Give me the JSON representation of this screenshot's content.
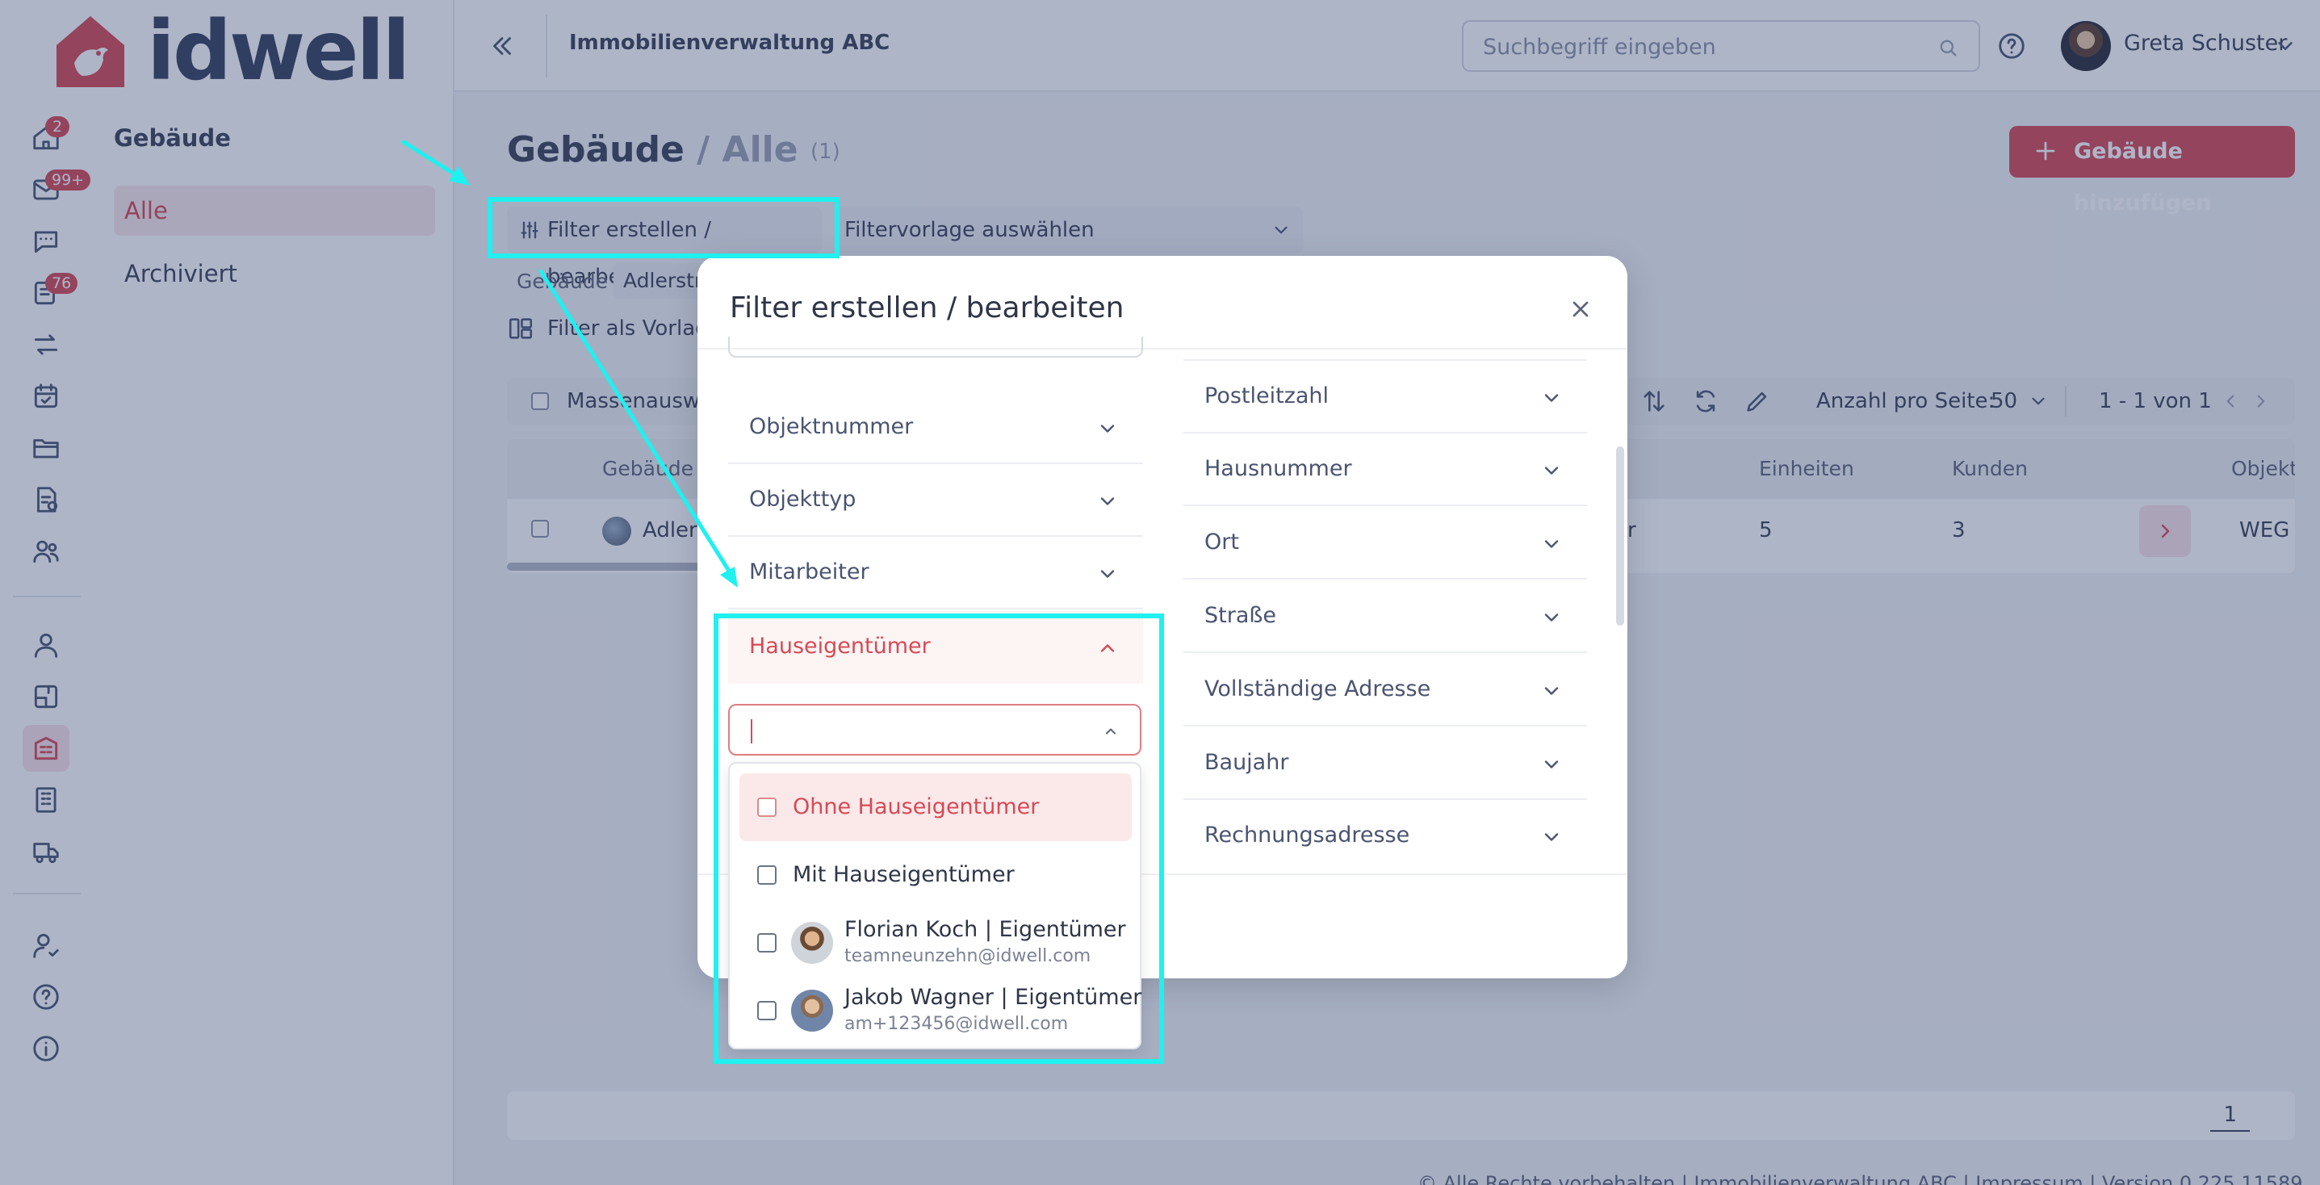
{
  "app": {
    "logo_text": "idwell",
    "org_name": "Immobilienverwaltung ABC"
  },
  "header": {
    "search_placeholder": "Suchbegriff eingeben",
    "user_name": "Greta Schuster"
  },
  "rail": {
    "badges": {
      "home": "2",
      "mail": "99+",
      "tasks": "76"
    }
  },
  "subnav": {
    "title": "Gebäude",
    "items": [
      {
        "label": "Alle",
        "active": true
      },
      {
        "label": "Archiviert",
        "active": false
      }
    ]
  },
  "page": {
    "title": "Gebäude",
    "title_sep": "/",
    "title_filter": "Alle",
    "count": "(1)",
    "add_button": "Gebäude hinzufügen"
  },
  "filters": {
    "edit_button": "Filter erstellen / bearbeiten",
    "template_select": "Filtervorlage auswählen",
    "chip_label": "Gebäude",
    "chip_value": "Adlerstr",
    "save_as_template": "Filter als Vorlag"
  },
  "toolbar": {
    "mass_action": "Massenausw",
    "per_page_label": "Anzahl pro Seite:",
    "per_page_value": "50",
    "range": "1 - 1 von 1"
  },
  "table": {
    "headers": {
      "building": "Gebäude",
      "units": "Einheiten",
      "customers": "Kunden",
      "object": "Objekt"
    },
    "row": {
      "building": "Adler",
      "partial": "er",
      "units": "5",
      "customers": "3",
      "object": "WEG"
    }
  },
  "footer": {
    "page": "1",
    "copyright": "© Alle Rechte vorbehalten | Immobilienverwaltung ABC | Impressum | Version 0.225.11589"
  },
  "modal": {
    "title": "Filter erstellen / bearbeiten",
    "left_fields": [
      "Objektnummer",
      "Objekttyp",
      "Mitarbeiter"
    ],
    "active_field": "Hauseigentümer",
    "right_fields": [
      "Postleitzahl",
      "Hausnummer",
      "Ort",
      "Straße",
      "Vollständige Adresse",
      "Baujahr",
      "Rechnungsadresse"
    ],
    "owner_options": {
      "none": "Ohne Hauseigentümer",
      "with": "Mit Hauseigentümer",
      "users": [
        {
          "name": "Florian Koch | Eigentümer",
          "email": "teamneunzehn@idwell.com"
        },
        {
          "name": "Jakob Wagner | Eigentümer",
          "email": "am+123456@idwell.com"
        }
      ]
    }
  },
  "colors": {
    "brand": "#d64a55",
    "highlight": "#1ff0f0",
    "text": "#3a4256"
  }
}
